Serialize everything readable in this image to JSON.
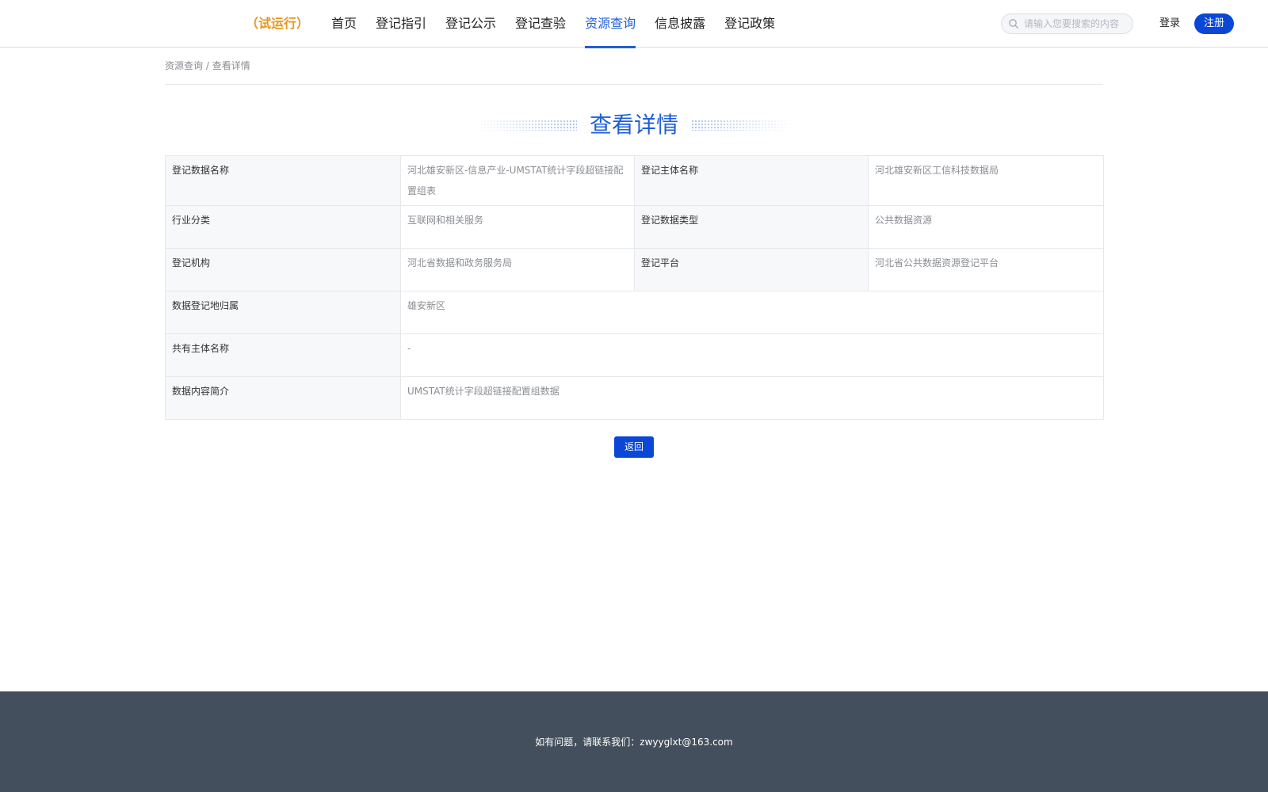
{
  "header": {
    "trial_label": "（试运行）",
    "nav": [
      {
        "label": "首页"
      },
      {
        "label": "登记指引"
      },
      {
        "label": "登记公示"
      },
      {
        "label": "登记查验"
      },
      {
        "label": "资源查询",
        "active": true
      },
      {
        "label": "信息披露"
      },
      {
        "label": "登记政策"
      }
    ],
    "search_placeholder": "请输入您要搜索的内容",
    "login_label": "登录",
    "register_label": "注册"
  },
  "breadcrumb": {
    "parent": "资源查询",
    "separator": " / ",
    "current": "查看详情"
  },
  "page_title": "查看详情",
  "details": {
    "name_label": "登记数据名称",
    "name_value": "河北雄安新区-信息产业-UMSTAT统计字段超链接配置组表",
    "subject_label": "登记主体名称",
    "subject_value": "河北雄安新区工信科技数据局",
    "industry_label": "行业分类",
    "industry_value": "互联网和相关服务",
    "type_label": "登记数据类型",
    "type_value": "公共数据资源",
    "agency_label": "登记机构",
    "agency_value": "河北省数据和政务服务局",
    "platform_label": "登记平台",
    "platform_value": "河北省公共数据资源登记平台",
    "region_label": "数据登记地归属",
    "region_value": "雄安新区",
    "co_owner_label": "共有主体名称",
    "co_owner_value": "-",
    "summary_label": "数据内容简介",
    "summary_value": "UMSTAT统计字段超链接配置组数据"
  },
  "back_label": "返回",
  "footer": {
    "contact": "如有问题，请联系我们：zwyyglxt@163.com"
  },
  "colors": {
    "brand_blue": "#0a47d6",
    "active_blue": "#1f5fd6",
    "trial_orange": "#e8961e",
    "footer_bg": "#434f5c"
  },
  "icons": {
    "search": "search-icon"
  }
}
